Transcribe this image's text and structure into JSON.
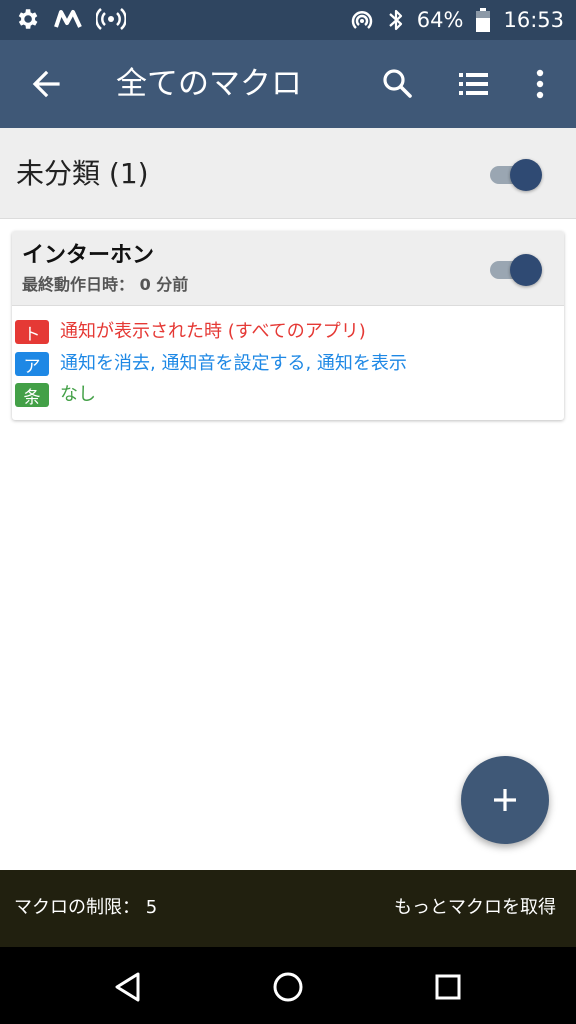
{
  "statusbar": {
    "battery": "64%",
    "time": "16:53",
    "icons": [
      "settings-gear-icon",
      "m-logo-icon",
      "hotspot-icon",
      "nfc-icon",
      "bluetooth-icon",
      "battery-icon"
    ]
  },
  "toolbar": {
    "title": "全てのマクロ",
    "icons": [
      "back-arrow-icon",
      "search-icon",
      "list-icon",
      "more-vert-icon"
    ]
  },
  "category": {
    "label": "未分類 (1)",
    "enabled": true
  },
  "macro": {
    "name": "インターホン",
    "last_run": "最終動作日時： 0 分前",
    "enabled": true,
    "rows": [
      {
        "badge": "ト",
        "text": "通知が表示された時 (すべてのアプリ)",
        "color": "#e53935",
        "badge_color": "#e53935"
      },
      {
        "badge": "ア",
        "text": "通知を消去, 通知音を設定する, 通知を表示",
        "color": "#1e88e5",
        "badge_color": "#1e88e5"
      },
      {
        "badge": "条",
        "text": "なし",
        "color": "#43a047",
        "badge_color": "#43a047"
      }
    ]
  },
  "fab": {
    "icon": "plus-icon"
  },
  "infobar": {
    "limit": "マクロの制限： 5",
    "get_more": "もっとマクロを取得"
  },
  "navbar": {
    "icons": [
      "back-triangle-icon",
      "home-circle-icon",
      "recents-square-icon"
    ]
  },
  "colors": {
    "statusbar": "#2f4560",
    "toolbar": "#3f5877",
    "switch_thumb": "#2f4a73",
    "infobar": "#21200f"
  }
}
